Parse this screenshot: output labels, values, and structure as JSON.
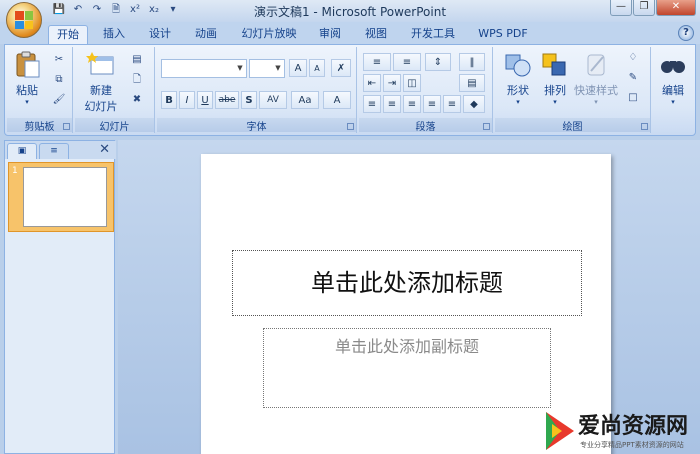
{
  "window": {
    "title": "演示文稿1 - Microsoft PowerPoint"
  },
  "tabs": [
    "开始",
    "插入",
    "设计",
    "动画",
    "幻灯片放映",
    "审阅",
    "视图",
    "开发工具",
    "WPS PDF"
  ],
  "groups": {
    "clipboard": {
      "label": "剪贴板",
      "paste": "粘贴"
    },
    "slides": {
      "label": "幻灯片",
      "new_slide": "新建",
      "new_slide_2": "幻灯片"
    },
    "font": {
      "label": "字体",
      "bold": "B",
      "italic": "I",
      "underline": "U",
      "strike": "abe",
      "shadow": "S",
      "spacing": "AV",
      "case": "Aa",
      "color": "A",
      "grow": "A",
      "shrink": "A"
    },
    "paragraph": {
      "label": "段落"
    },
    "drawing": {
      "label": "绘图",
      "shapes": "形状",
      "arrange": "排列",
      "quick_styles": "快速样式"
    },
    "editing": {
      "label": "编辑",
      "edit": "编辑"
    }
  },
  "slide_pane": {
    "slide_number": "1"
  },
  "slide": {
    "title_placeholder": "单击此处添加标题",
    "subtitle_placeholder": "单击此处添加副标题"
  },
  "watermark": {
    "brand": "爱尚资源网",
    "tagline": "专业分享精品PPT素材资源的网站"
  },
  "colors": {
    "accent": "#15428b",
    "ribbon": "#dbe7f7",
    "selected_thumb": "#f7c36a"
  }
}
